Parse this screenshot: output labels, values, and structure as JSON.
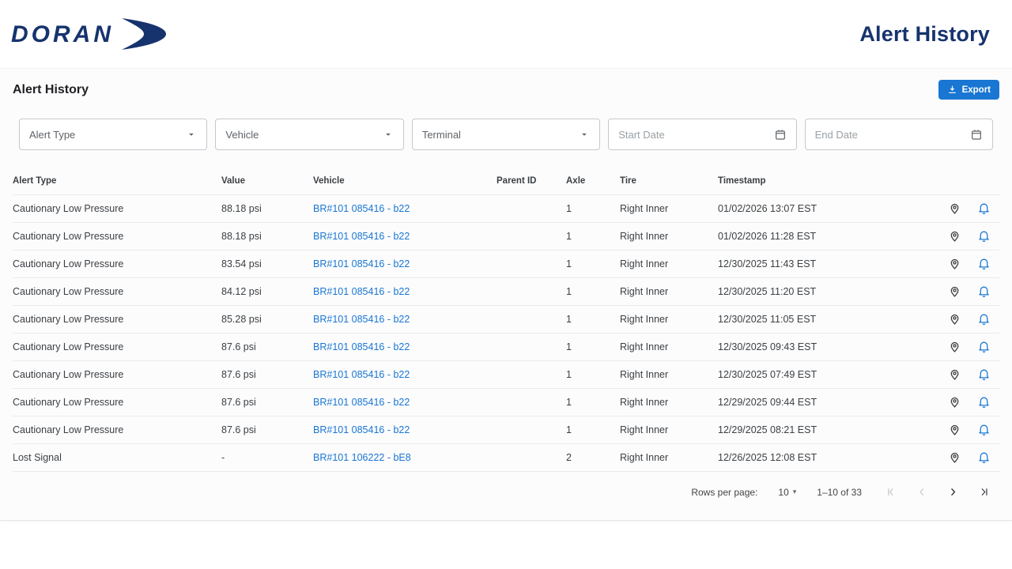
{
  "colors": {
    "accent": "#1976d2",
    "brand": "#16336e",
    "link": "#1976d2"
  },
  "header": {
    "logo_text": "DORAN",
    "title": "Alert History"
  },
  "main": {
    "title": "Alert History",
    "export_button": {
      "label": "Export",
      "icon": "download-icon"
    }
  },
  "filters": [
    {
      "label": "Alert Type",
      "type": "select",
      "icon": "chevron-down-icon"
    },
    {
      "label": "Vehicle",
      "type": "select",
      "icon": "chevron-down-icon"
    },
    {
      "label": "Terminal",
      "type": "select",
      "icon": "chevron-down-icon"
    },
    {
      "label": "Start Date",
      "type": "date",
      "placeholder": "Start Date",
      "icon": "calendar-icon"
    },
    {
      "label": "End Date",
      "type": "date",
      "placeholder": "End Date",
      "icon": "calendar-icon"
    }
  ],
  "table": {
    "columns": [
      "Alert Type",
      "Value",
      "Vehicle",
      "Parent ID",
      "Axle",
      "Tire",
      "Timestamp"
    ],
    "row_action_icons": [
      "location-pin-icon",
      "bell-icon"
    ],
    "rows": [
      {
        "alert_type": "Cautionary Low Pressure",
        "value": "88.18 psi",
        "vehicle": "BR#101 085416 - b22",
        "parent_id": "",
        "axle": "1",
        "tire": "Right Inner",
        "timestamp": "01/02/2026 13:07 EST"
      },
      {
        "alert_type": "Cautionary Low Pressure",
        "value": "88.18 psi",
        "vehicle": "BR#101 085416 - b22",
        "parent_id": "",
        "axle": "1",
        "tire": "Right Inner",
        "timestamp": "01/02/2026 11:28 EST"
      },
      {
        "alert_type": "Cautionary Low Pressure",
        "value": "83.54 psi",
        "vehicle": "BR#101 085416 - b22",
        "parent_id": "",
        "axle": "1",
        "tire": "Right Inner",
        "timestamp": "12/30/2025 11:43 EST"
      },
      {
        "alert_type": "Cautionary Low Pressure",
        "value": "84.12 psi",
        "vehicle": "BR#101 085416 - b22",
        "parent_id": "",
        "axle": "1",
        "tire": "Right Inner",
        "timestamp": "12/30/2025 11:20 EST"
      },
      {
        "alert_type": "Cautionary Low Pressure",
        "value": "85.28 psi",
        "vehicle": "BR#101 085416 - b22",
        "parent_id": "",
        "axle": "1",
        "tire": "Right Inner",
        "timestamp": "12/30/2025 11:05 EST"
      },
      {
        "alert_type": "Cautionary Low Pressure",
        "value": "87.6 psi",
        "vehicle": "BR#101 085416 - b22",
        "parent_id": "",
        "axle": "1",
        "tire": "Right Inner",
        "timestamp": "12/30/2025 09:43 EST"
      },
      {
        "alert_type": "Cautionary Low Pressure",
        "value": "87.6 psi",
        "vehicle": "BR#101 085416 - b22",
        "parent_id": "",
        "axle": "1",
        "tire": "Right Inner",
        "timestamp": "12/30/2025 07:49 EST"
      },
      {
        "alert_type": "Cautionary Low Pressure",
        "value": "87.6 psi",
        "vehicle": "BR#101 085416 - b22",
        "parent_id": "",
        "axle": "1",
        "tire": "Right Inner",
        "timestamp": "12/29/2025 09:44 EST"
      },
      {
        "alert_type": "Cautionary Low Pressure",
        "value": "87.6 psi",
        "vehicle": "BR#101 085416 - b22",
        "parent_id": "",
        "axle": "1",
        "tire": "Right Inner",
        "timestamp": "12/29/2025 08:21 EST"
      },
      {
        "alert_type": "Lost Signal",
        "value": "-",
        "vehicle": "BR#101 106222 - bE8",
        "parent_id": "",
        "axle": "2",
        "tire": "Right Inner",
        "timestamp": "12/26/2025 12:08 EST"
      }
    ]
  },
  "pagination": {
    "rows_per_page_label": "Rows per page:",
    "rows_per_page_value": "10",
    "range_label": "1–10 of 33",
    "nav": [
      {
        "name": "first-page",
        "icon": "first-page-icon",
        "enabled": false
      },
      {
        "name": "previous-page",
        "icon": "chevron-left-icon",
        "enabled": false
      },
      {
        "name": "next-page",
        "icon": "chevron-right-icon",
        "enabled": true
      },
      {
        "name": "last-page",
        "icon": "last-page-icon",
        "enabled": true
      }
    ]
  }
}
